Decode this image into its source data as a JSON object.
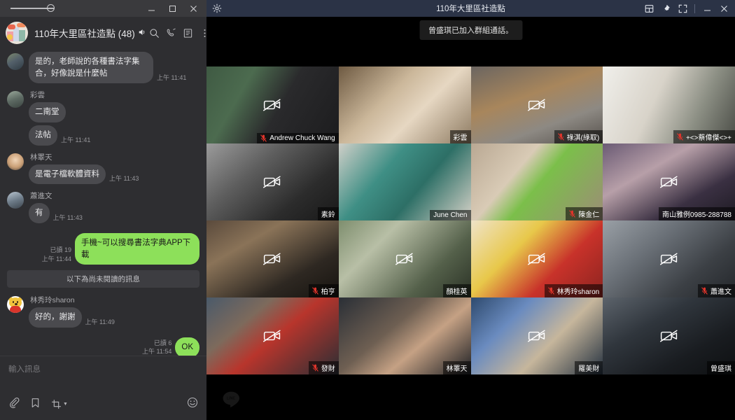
{
  "chat_window": {
    "titlebar": {
      "slider_name": "window-opacity-slider",
      "minimize": "—",
      "maximize": "▢",
      "close": "✕"
    },
    "header": {
      "group_name": "110年大里區社造點 (48)",
      "mute_icon": "speaker-icon",
      "icons": [
        "search-icon",
        "call-icon",
        "note-icon",
        "more-icon"
      ]
    },
    "messages": [
      {
        "type": "incoming_continued",
        "sender": "",
        "avatar": "av-a",
        "text": "是的，老師說的各種書法字集合，好像說是什麼帖",
        "time": "上午 11:41"
      },
      {
        "type": "incoming",
        "sender": "彩雲",
        "avatar": "av-b",
        "bubbles": [
          {
            "text": "二南堂",
            "time": ""
          },
          {
            "text": "法帖",
            "time": "上午 11:41"
          }
        ]
      },
      {
        "type": "incoming",
        "sender": "林睪天",
        "avatar": "av-c",
        "bubbles": [
          {
            "text": "是電子檔軟體資料",
            "time": "上午 11:43"
          }
        ]
      },
      {
        "type": "incoming",
        "sender": "蕭進文",
        "avatar": "av-d",
        "bubbles": [
          {
            "text": "有",
            "time": "上午 11:43"
          }
        ]
      },
      {
        "type": "outgoing",
        "read_label": "已讀 19",
        "time": "上午 11:44",
        "text": "手機~可以搜尋書法字典APP下載"
      },
      {
        "type": "divider",
        "text": "以下為尚未閱讀的訊息"
      },
      {
        "type": "incoming",
        "sender": "林秀玲sharon",
        "avatar": "av-e",
        "bubbles": [
          {
            "text": "好的，謝謝",
            "time": "上午 11:49"
          }
        ]
      },
      {
        "type": "outgoing",
        "read_label": "已讀 6",
        "time": "上午 11:54",
        "text": "OK"
      }
    ],
    "composer": {
      "placeholder": "輸入訊息",
      "tools": [
        "attach-icon",
        "bookmark-icon",
        "screenshot-icon",
        "emoji-icon"
      ]
    }
  },
  "call_window": {
    "titlebar": {
      "gear_icon": "gear-icon",
      "title": "110年大里區社造點",
      "icons": [
        "grid-layout-icon",
        "pin-icon",
        "fullscreen-icon"
      ],
      "minimize": "—",
      "close": "✕"
    },
    "toast": "曾盛琪已加入群組通話。",
    "watermark": "LINE",
    "participants": [
      {
        "name": "Andrew Chuck Wang",
        "muted": true,
        "camera_off": true,
        "active": false,
        "span": 1,
        "bg": "p-andrew"
      },
      {
        "name": "彩雲",
        "muted": false,
        "camera_off": false,
        "active": true,
        "span": 1,
        "bg": "p-caiyun"
      },
      {
        "name": "祿淇(綠取)",
        "muted": true,
        "camera_off": true,
        "active": false,
        "span": 1,
        "bg": "p-dog"
      },
      {
        "name": "+<>蔡偉傑<>+",
        "muted": true,
        "camera_off": false,
        "active": false,
        "span": 1,
        "bg": "p-wei"
      },
      {
        "name": "素鈴",
        "muted": false,
        "camera_off": true,
        "active": false,
        "span": 1,
        "bg": "p-suling"
      },
      {
        "name": "June Chen",
        "muted": false,
        "camera_off": false,
        "active": false,
        "span": 1,
        "bg": "p-june"
      },
      {
        "name": "陳金仁",
        "muted": true,
        "camera_off": false,
        "active": false,
        "span": 1,
        "bg": "p-chen"
      },
      {
        "name": "南山雅例0985-288788",
        "muted": false,
        "camera_off": true,
        "active": false,
        "span": 1,
        "bg": "p-nanshan"
      },
      {
        "name": "柏亨",
        "muted": true,
        "camera_off": true,
        "active": false,
        "span": 1,
        "bg": "p-boheng"
      },
      {
        "name": "顏桂英",
        "muted": false,
        "camera_off": true,
        "active": false,
        "span": 1,
        "bg": "p-yan"
      },
      {
        "name": "林秀玲sharon",
        "muted": true,
        "camera_off": true,
        "active": false,
        "span": 1,
        "bg": "p-pooh"
      },
      {
        "name": "蕭進文",
        "muted": true,
        "camera_off": true,
        "active": false,
        "span": 1,
        "bg": "p-xiao"
      },
      {
        "name": "發財",
        "muted": true,
        "camera_off": true,
        "active": false,
        "span": 1,
        "bg": "p-facai"
      },
      {
        "name": "林睪天",
        "muted": false,
        "camera_off": false,
        "active": false,
        "span": 1,
        "bg": "p-lin"
      },
      {
        "name": "羅美財",
        "muted": false,
        "camera_off": true,
        "active": false,
        "span": 1,
        "bg": "p-luo"
      },
      {
        "name": "曾盛琪",
        "muted": false,
        "camera_off": true,
        "active": false,
        "span": 1,
        "bg": "p-zeng"
      }
    ]
  },
  "colors": {
    "accent_green": "#8de05a",
    "active_border": "#3ddc52",
    "chat_bg": "#2e2e31",
    "bubble_in": "#4a4a4e",
    "call_titlebar": "#2b3346",
    "mute_red": "#e0342b"
  }
}
